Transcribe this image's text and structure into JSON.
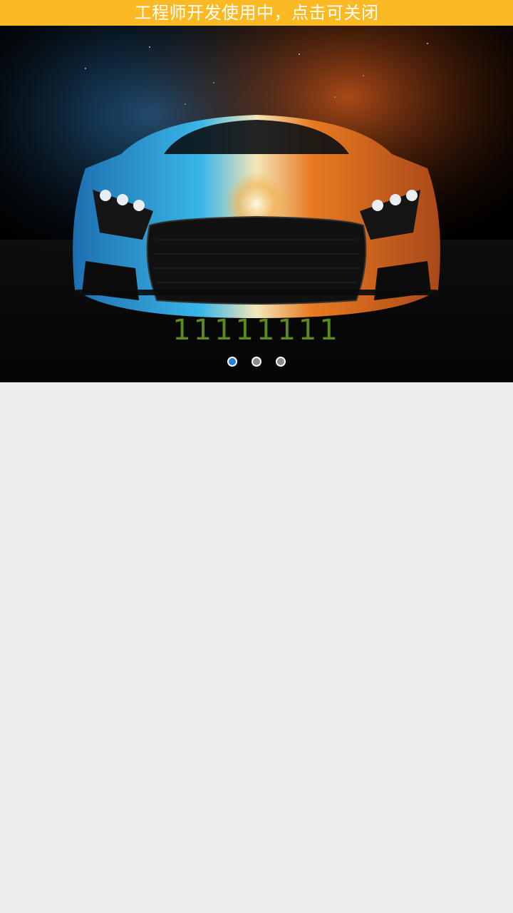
{
  "banner": {
    "text": "工程师开发使用中，点击可关闭",
    "color": "#fbb924"
  },
  "slider": {
    "caption": "11111111",
    "caption_color": "#5c8a1e",
    "slide_count": 3,
    "active_index": 0,
    "dot_active_color": "#2b7fd8",
    "dot_inactive_color": "#8a8a8a",
    "image": "sports-car-blue-orange"
  },
  "page": {
    "background": "#ededed"
  }
}
